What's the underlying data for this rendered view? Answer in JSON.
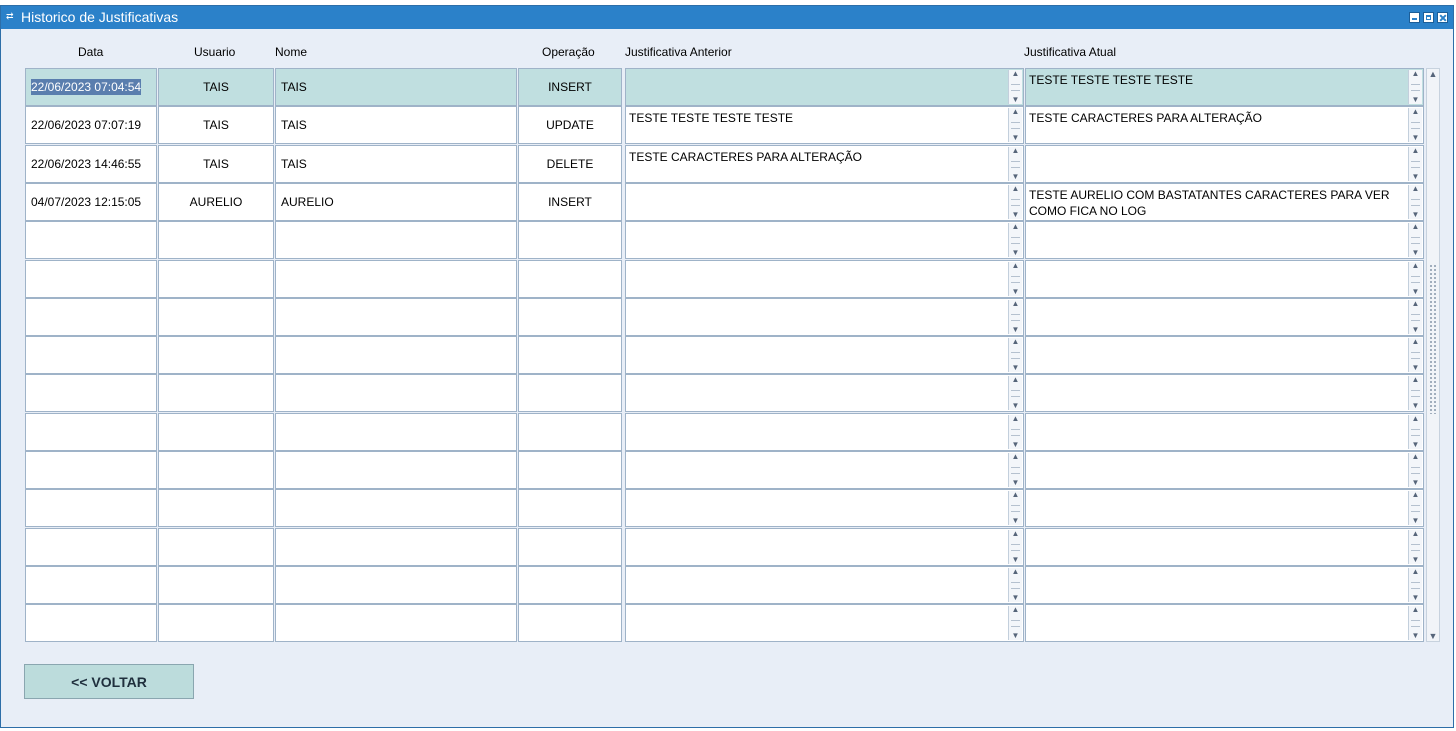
{
  "window": {
    "title": "Historico de Justificativas"
  },
  "columns": {
    "data": "Data",
    "usuario": "Usuario",
    "nome": "Nome",
    "operacao": "Operação",
    "justificativa_anterior": "Justificativa Anterior",
    "justificativa_atual": "Justificativa Atual"
  },
  "rows": [
    {
      "data": "22/06/2023 07:04:54",
      "usuario": "TAIS",
      "nome": "TAIS",
      "operacao": "INSERT",
      "justificativa_anterior": "",
      "justificativa_atual": "TESTE TESTE TESTE TESTE"
    },
    {
      "data": "22/06/2023 07:07:19",
      "usuario": "TAIS",
      "nome": "TAIS",
      "operacao": "UPDATE",
      "justificativa_anterior": "TESTE TESTE TESTE TESTE",
      "justificativa_atual": "TESTE CARACTERES PARA ALTERAÇÃO"
    },
    {
      "data": "22/06/2023 14:46:55",
      "usuario": "TAIS",
      "nome": "TAIS",
      "operacao": "DELETE",
      "justificativa_anterior": "TESTE CARACTERES PARA ALTERAÇÃO",
      "justificativa_atual": ""
    },
    {
      "data": "04/07/2023 12:15:05",
      "usuario": "AURELIO",
      "nome": "AURELIO",
      "operacao": "INSERT",
      "justificativa_anterior": "",
      "justificativa_atual": "TESTE AURELIO COM BASTATANTES CARACTERES PARA VER COMO FICA NO LOG"
    },
    {
      "data": "",
      "usuario": "",
      "nome": "",
      "operacao": "",
      "justificativa_anterior": "",
      "justificativa_atual": ""
    },
    {
      "data": "",
      "usuario": "",
      "nome": "",
      "operacao": "",
      "justificativa_anterior": "",
      "justificativa_atual": ""
    },
    {
      "data": "",
      "usuario": "",
      "nome": "",
      "operacao": "",
      "justificativa_anterior": "",
      "justificativa_atual": ""
    },
    {
      "data": "",
      "usuario": "",
      "nome": "",
      "operacao": "",
      "justificativa_anterior": "",
      "justificativa_atual": ""
    },
    {
      "data": "",
      "usuario": "",
      "nome": "",
      "operacao": "",
      "justificativa_anterior": "",
      "justificativa_atual": ""
    },
    {
      "data": "",
      "usuario": "",
      "nome": "",
      "operacao": "",
      "justificativa_anterior": "",
      "justificativa_atual": ""
    },
    {
      "data": "",
      "usuario": "",
      "nome": "",
      "operacao": "",
      "justificativa_anterior": "",
      "justificativa_atual": ""
    },
    {
      "data": "",
      "usuario": "",
      "nome": "",
      "operacao": "",
      "justificativa_anterior": "",
      "justificativa_atual": ""
    },
    {
      "data": "",
      "usuario": "",
      "nome": "",
      "operacao": "",
      "justificativa_anterior": "",
      "justificativa_atual": ""
    },
    {
      "data": "",
      "usuario": "",
      "nome": "",
      "operacao": "",
      "justificativa_anterior": "",
      "justificativa_atual": ""
    },
    {
      "data": "",
      "usuario": "",
      "nome": "",
      "operacao": "",
      "justificativa_anterior": "",
      "justificativa_atual": ""
    }
  ],
  "buttons": {
    "voltar": "<< VOLTAR"
  },
  "colors": {
    "titlebar": "#2b81c9",
    "window_bg": "#e8eef7",
    "selected_row": "#c0dfe0",
    "button_bg": "#bcdcdc",
    "date_highlight": "#5a7eae"
  },
  "icons": {
    "app": "app-icon",
    "minimize": "minimize-icon",
    "maximize": "maximize-icon",
    "close": "close-icon",
    "spin_up": "arrow-up-icon",
    "spin_down": "arrow-down-icon"
  }
}
